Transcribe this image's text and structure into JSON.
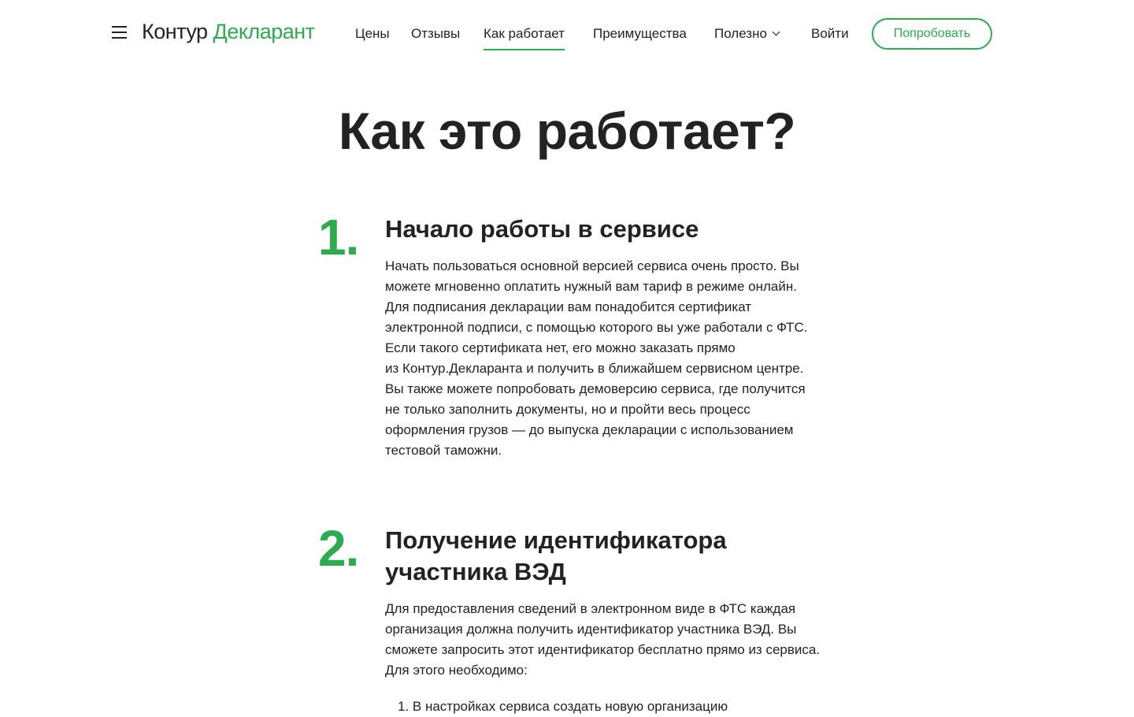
{
  "header": {
    "logo_brand": "Контур",
    "logo_product": "Декларант",
    "nav": [
      {
        "label": "Цены"
      },
      {
        "label": "Отзывы"
      },
      {
        "label": "Как работает"
      },
      {
        "label": "Преимущества"
      },
      {
        "label": "Полезно"
      },
      {
        "label": "Войти"
      }
    ],
    "try_button": "Попробовать"
  },
  "main": {
    "title": "Как это работает?",
    "steps": [
      {
        "number": "1.",
        "title": "Начало работы в сервисе",
        "lines": [
          "Начать пользоваться основной версией сервиса очень просто. Вы",
          "можете мгновенно оплатить нужный вам тариф в режиме онлайн.",
          "Для подписания декларации вам понадобится сертификат",
          "электронной подписи, с помощью которого вы уже работали с ФТС.",
          "Если такого сертификата нет, его можно заказать прямо",
          "из Контур.Декларанта и получить в ближайшем сервисном центре.",
          "Вы также можете попробовать демоверсию сервиса, где получится",
          "не только заполнить документы, но и пройти весь процесс",
          "оформления грузов — до выпуска декларации с использованием",
          "тестовой таможни."
        ]
      },
      {
        "number": "2.",
        "title_lines": [
          "Получение идентификатора",
          "участника ВЭД"
        ],
        "lines": [
          "Для предоставления сведений в электронном виде в ФТС каждая",
          "организация должна получить идентификатор участника ВЭД. Вы",
          "сможете запросить этот идентификатор бесплатно прямо из сервиса.",
          "Для этого необходимо:"
        ],
        "list": [
          "1. В настройках сервиса создать новую организацию"
        ]
      }
    ]
  }
}
